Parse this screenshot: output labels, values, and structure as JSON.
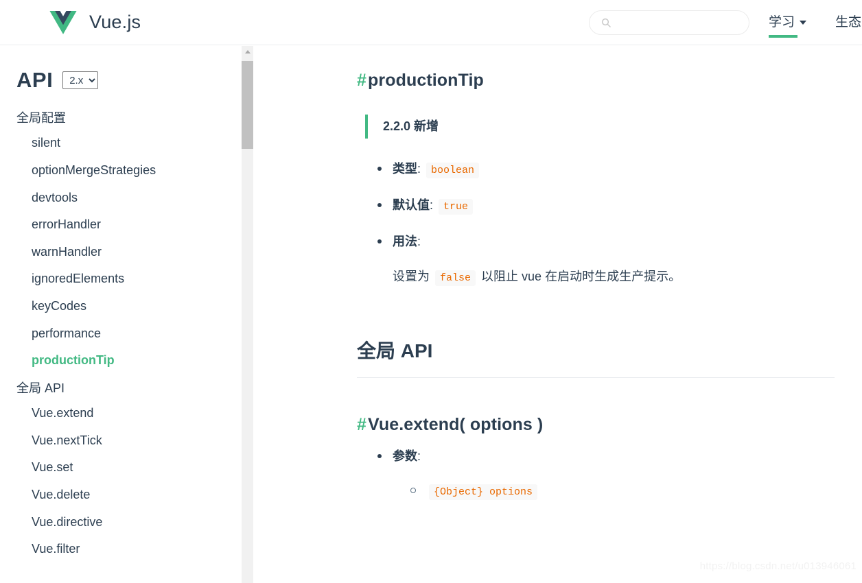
{
  "header": {
    "brand": "Vue.js",
    "logo_icon": "vue-logo-icon",
    "search": {
      "icon": "search-icon",
      "value": "",
      "placeholder": ""
    },
    "nav": [
      {
        "label": "学习",
        "has_caret": true,
        "active": true
      },
      {
        "label": "生态系",
        "has_caret": false,
        "active": false
      }
    ]
  },
  "sidebar": {
    "title": "API",
    "version_select": {
      "value": "2.x",
      "options": [
        "2.x"
      ]
    },
    "groups": [
      {
        "title": "全局配置",
        "items": [
          {
            "label": "silent",
            "active": false
          },
          {
            "label": "optionMergeStrategies",
            "active": false
          },
          {
            "label": "devtools",
            "active": false
          },
          {
            "label": "errorHandler",
            "active": false
          },
          {
            "label": "warnHandler",
            "active": false
          },
          {
            "label": "ignoredElements",
            "active": false
          },
          {
            "label": "keyCodes",
            "active": false
          },
          {
            "label": "performance",
            "active": false
          },
          {
            "label": "productionTip",
            "active": true
          }
        ]
      },
      {
        "title": "全局 API",
        "items": [
          {
            "label": "Vue.extend",
            "active": false
          },
          {
            "label": "Vue.nextTick",
            "active": false
          },
          {
            "label": "Vue.set",
            "active": false
          },
          {
            "label": "Vue.delete",
            "active": false
          },
          {
            "label": "Vue.directive",
            "active": false
          },
          {
            "label": "Vue.filter",
            "active": false
          }
        ]
      }
    ]
  },
  "scrollbar": {
    "arrow_icon": "chevron-up-icon"
  },
  "content": {
    "hash": "#",
    "heading_production_tip": "productionTip",
    "tip": "2.2.0 新增",
    "list": [
      {
        "label": "类型",
        "colon": ":",
        "code": "boolean"
      },
      {
        "label": "默认值",
        "colon": ":",
        "code": "true"
      },
      {
        "label": "用法",
        "colon": ":",
        "code": ""
      }
    ],
    "usage": {
      "before": "设置为",
      "code": "false",
      "after": "以阻止 vue 在启动时生成生产提示。"
    },
    "section_heading": "全局 API",
    "heading_vue_extend": "Vue.extend( options )",
    "params_label": "参数",
    "params_colon": ":",
    "param_code": "{Object} options"
  },
  "watermark": "https://blog.csdn.net/u013946061"
}
